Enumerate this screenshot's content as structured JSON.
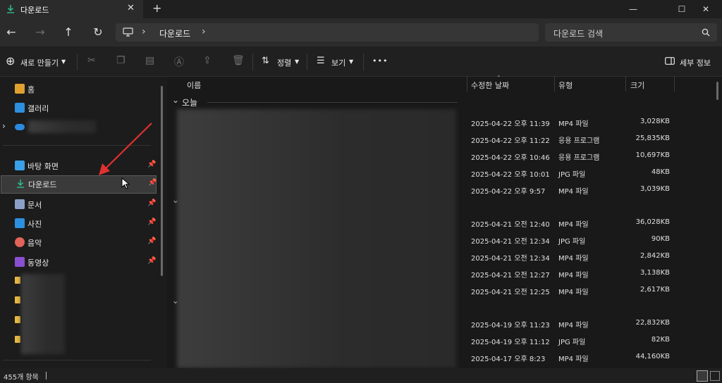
{
  "tab": {
    "title": "다운로드",
    "new_tab": "+"
  },
  "window": {
    "minimize": "—",
    "maximize": "☐",
    "close": "✕"
  },
  "nav": {
    "back": "←",
    "forward": "→",
    "up": "↑",
    "refresh": "↻"
  },
  "address": {
    "sep1": "›",
    "location": "다운로드",
    "sep2": "›"
  },
  "search": {
    "placeholder": "다운로드 검색"
  },
  "toolbar": {
    "new_label": "새로 만들기",
    "sort_label": "정렬",
    "view_label": "보기",
    "more": "•••",
    "details_label": "세부 정보"
  },
  "sidebar": {
    "top_items": [
      {
        "label": "홈",
        "icon": "home-icon"
      },
      {
        "label": "갤러리",
        "icon": "gallery-icon"
      },
      {
        "label": "",
        "icon": "onedrive-icon"
      }
    ],
    "pinned": [
      {
        "label": "바탕 화면",
        "icon": "desktop-icon",
        "color": "#3aa0e8"
      },
      {
        "label": "다운로드",
        "icon": "download-icon",
        "color": "#2fb38a"
      },
      {
        "label": "문서",
        "icon": "document-icon",
        "color": "#8aa0c8"
      },
      {
        "label": "사진",
        "icon": "pictures-icon",
        "color": "#2d8fe0"
      },
      {
        "label": "음악",
        "icon": "music-icon",
        "color": "#e0645a"
      },
      {
        "label": "동영상",
        "icon": "video-icon",
        "color": "#8a4fd0"
      }
    ]
  },
  "columns": {
    "name": "이름",
    "modified": "수정한 날짜",
    "type": "유형",
    "size": "크기"
  },
  "groups": {
    "today": "오늘"
  },
  "files": [
    {
      "date": "2025-04-22 오후 11:39",
      "type": "MP4 파일",
      "size": "3,028KB"
    },
    {
      "date": "2025-04-22 오후 11:22",
      "type": "응용 프로그램",
      "size": "25,835KB"
    },
    {
      "date": "2025-04-22 오후 10:46",
      "type": "응용 프로그램",
      "size": "10,697KB"
    },
    {
      "date": "2025-04-22 오후 10:01",
      "type": "JPG 파일",
      "size": "48KB"
    },
    {
      "date": "2025-04-22 오후 9:57",
      "type": "MP4 파일",
      "size": "3,039KB"
    },
    {
      "date": "2025-04-21 오전 12:40",
      "type": "MP4 파일",
      "size": "36,028KB"
    },
    {
      "date": "2025-04-21 오전 12:34",
      "type": "JPG 파일",
      "size": "90KB"
    },
    {
      "date": "2025-04-21 오전 12:34",
      "type": "MP4 파일",
      "size": "2,842KB"
    },
    {
      "date": "2025-04-21 오전 12:27",
      "type": "MP4 파일",
      "size": "3,138KB"
    },
    {
      "date": "2025-04-21 오전 12:25",
      "type": "MP4 파일",
      "size": "2,617KB"
    },
    {
      "date": "2025-04-19 오후 11:23",
      "type": "MP4 파일",
      "size": "22,832KB"
    },
    {
      "date": "2025-04-19 오후 11:12",
      "type": "JPG 파일",
      "size": "82KB"
    },
    {
      "date": "2025-04-17 오후 8:23",
      "type": "MP4 파일",
      "size": "44,160KB"
    }
  ],
  "status": {
    "count": "455개 항목"
  }
}
